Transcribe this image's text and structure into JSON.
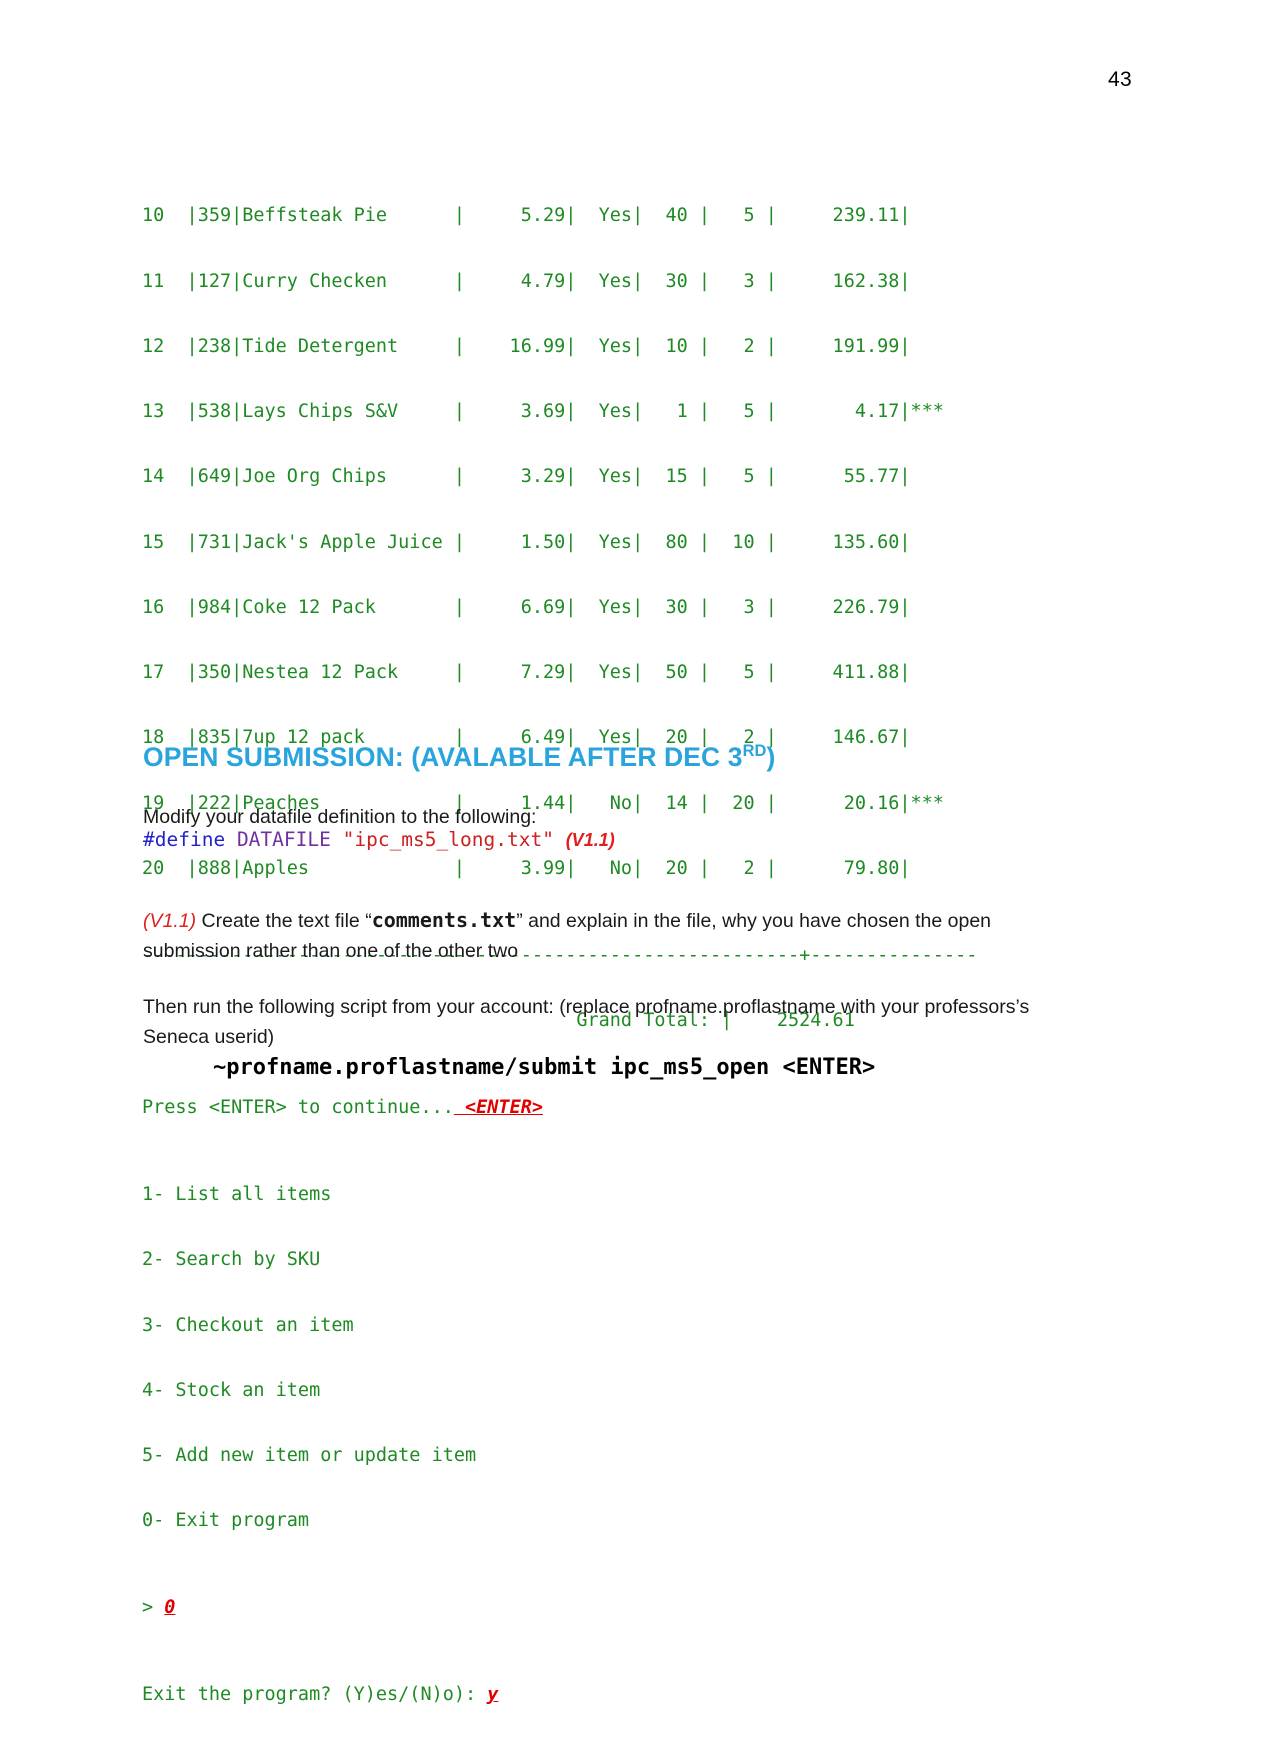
{
  "page": {
    "number": "43"
  },
  "console": {
    "table_rows": [
      "10  |359|Beffsteak Pie      |     5.29|  Yes|  40 |   5 |     239.11|",
      "11  |127|Curry Checken      |     4.79|  Yes|  30 |   3 |     162.38|",
      "12  |238|Tide Detergent     |    16.99|  Yes|  10 |   2 |     191.99|",
      "13  |538|Lays Chips S&V     |     3.69|  Yes|   1 |   5 |       4.17|***",
      "14  |649|Joe Org Chips      |     3.29|  Yes|  15 |   5 |      55.77|",
      "15  |731|Jack's Apple Juice |     1.50|  Yes|  80 |  10 |     135.60|",
      "16  |984|Coke 12 Pack       |     6.69|  Yes|  30 |   3 |     226.79|",
      "17  |350|Nestea 12 Pack     |     7.29|  Yes|  50 |   5 |     411.88|",
      "18  |835|7up 12 pack        |     6.49|  Yes|  20 |   2 |     146.67|",
      "19  |222|Peaches            |     1.44|   No|  14 |  20 |      20.16|***",
      "20  |888|Apples             |     3.99|   No|  20 |   2 |      79.80|"
    ],
    "separator": "-----------------------------------------------------------+---------------",
    "grand_total_line": "                                       Grand Total: |    2524.61",
    "press_enter_prompt": "Press <ENTER> to continue...",
    "press_enter_input": " <ENTER>",
    "menu_items": [
      "1- List all items",
      "2- Search by SKU",
      "3- Checkout an item",
      "4- Stock an item",
      "5- Add new item or update item",
      "0- Exit program"
    ],
    "menu_prompt": "> ",
    "menu_input": "0",
    "exit_prompt": "Exit the program? (Y)es/(N)o): ",
    "exit_input": "y",
    "text_color": "#1f8a24",
    "annotation_color": "#e00000"
  },
  "section": {
    "heading_main": "OPEN SUBMISSION: (AVALABLE AFTER DEC 3",
    "heading_sup": "RD",
    "heading_tail": ")",
    "heading_color": "#29a4dd"
  },
  "paragraphs": {
    "modify_intro": "Modify your datafile definition to the following:",
    "create_version": "(V1.1)",
    "create_before_file": " Create the text file “",
    "create_filename": "comments.txt",
    "create_after_file": "” and explain in the file, why you have chosen the open submission rather than one of the other two",
    "run_script": "Then run the following script from your account: (replace profname.proflastname with your professors’s Seneca userid)"
  },
  "code": {
    "define_directive": "#define",
    "define_space1": " ",
    "define_macro": "DATAFILE",
    "define_space2": " ",
    "define_string": "\"ipc_ms5_long.txt\"",
    "define_space3": " ",
    "define_version": "(V1.1)"
  },
  "command": {
    "submit_line": "~profname.proflastname/submit ipc_ms5_open <ENTER>"
  }
}
